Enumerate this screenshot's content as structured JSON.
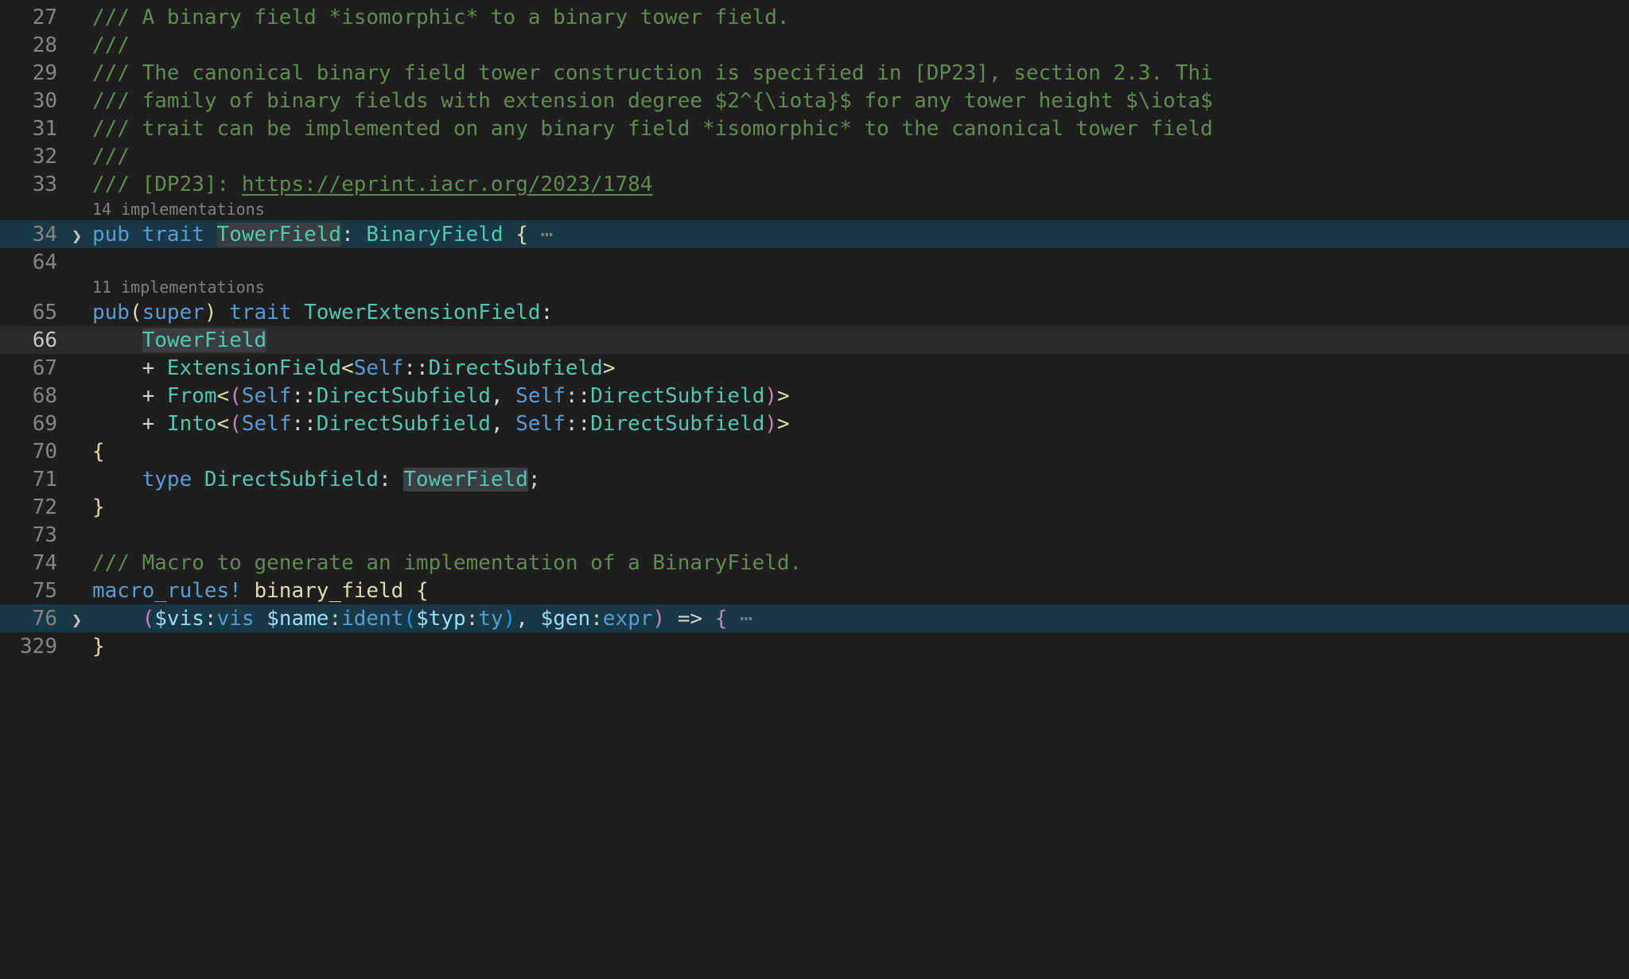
{
  "codelens": {
    "impl14": "14 implementations",
    "impl11": "11 implementations"
  },
  "gutter": {
    "l27": "27",
    "l28": "28",
    "l29": "29",
    "l30": "30",
    "l31": "31",
    "l32": "32",
    "l33": "33",
    "l34": "34",
    "l64": "64",
    "l65": "65",
    "l66": "66",
    "l67": "67",
    "l68": "68",
    "l69": "69",
    "l70": "70",
    "l71": "71",
    "l72": "72",
    "l73": "73",
    "l74": "74",
    "l75": "75",
    "l76": "76",
    "l329": "329"
  },
  "fold": {
    "chev": "❯"
  },
  "code": {
    "l27": "/// A binary field *isomorphic* to a binary tower field.",
    "l28": "///",
    "l29": "/// The canonical binary field tower construction is specified in [DP23], section 2.3. Thi",
    "l30": "/// family of binary fields with extension degree $2^{\\iota}$ for any tower height $\\iota$",
    "l31": "/// trait can be implemented on any binary field *isomorphic* to the canonical tower field",
    "l32": "///",
    "l33_a": "/// [DP23]: ",
    "l33_link": "https://eprint.iacr.org/2023/1784",
    "l34_pub": "pub",
    "l34_trait": " trait ",
    "l34_name": "TowerField",
    "l34_colon": ": ",
    "l34_base": "BinaryField",
    "l34_sp": " ",
    "l34_braceL": "{",
    "l34_dots": " ⋯",
    "l65_pub": "pub",
    "l65_lpar": "(",
    "l65_super": "super",
    "l65_rpar": ")",
    "l65_trait": " trait ",
    "l65_name": "TowerExtensionField",
    "l65_colon": ":",
    "l66_indent": "    ",
    "l66_name": "TowerField",
    "l67_indent": "    + ",
    "l67_name": "ExtensionField",
    "l67_lt": "<",
    "l67_self": "Self",
    "l67_cc": "::",
    "l67_assoc": "DirectSubfield",
    "l67_gt": ">",
    "l68_indent": "    + ",
    "l68_name": "From",
    "l68_lt": "<",
    "l68_lpar": "(",
    "l68_self": "Self",
    "l68_cc": "::",
    "l68_assoc": "DirectSubfield",
    "l68_comma": ", ",
    "l68_self2": "Self",
    "l68_cc2": "::",
    "l68_assoc2": "DirectSubfield",
    "l68_rpar": ")",
    "l68_gt": ">",
    "l69_indent": "    + ",
    "l69_name": "Into",
    "l69_lt": "<",
    "l69_lpar": "(",
    "l69_self": "Self",
    "l69_cc": "::",
    "l69_assoc": "DirectSubfield",
    "l69_comma": ", ",
    "l69_self2": "Self",
    "l69_cc2": "::",
    "l69_assoc2": "DirectSubfield",
    "l69_rpar": ")",
    "l69_gt": ">",
    "l70_brace": "{",
    "l71_indent": "    ",
    "l71_type": "type",
    "l71_sp": " ",
    "l71_name": "DirectSubfield",
    "l71_colon": ": ",
    "l71_tf": "TowerField",
    "l71_semi": ";",
    "l72_brace": "}",
    "l74": "/// Macro to generate an implementation of a BinaryField.",
    "l75_macro": "macro_rules!",
    "l75_sp": " ",
    "l75_name": "binary_field",
    "l75_sp2": " ",
    "l75_brace": "{",
    "l76_indent": "    ",
    "l76_lpar": "(",
    "l76_vis": "$vis",
    "l76_c1": ":",
    "l76_viskw": "vis",
    "l76_sp": " ",
    "l76_name": "$name",
    "l76_c2": ":",
    "l76_ident": "ident",
    "l76_lpar2": "(",
    "l76_typ": "$typ",
    "l76_c3": ":",
    "l76_ty": "ty",
    "l76_rpar2": ")",
    "l76_comma": ", ",
    "l76_gen": "$gen",
    "l76_c4": ":",
    "l76_expr": "expr",
    "l76_rpar": ")",
    "l76_arrow": " => ",
    "l76_brace": "{",
    "l76_dots": " ⋯",
    "l329_brace": "}"
  }
}
